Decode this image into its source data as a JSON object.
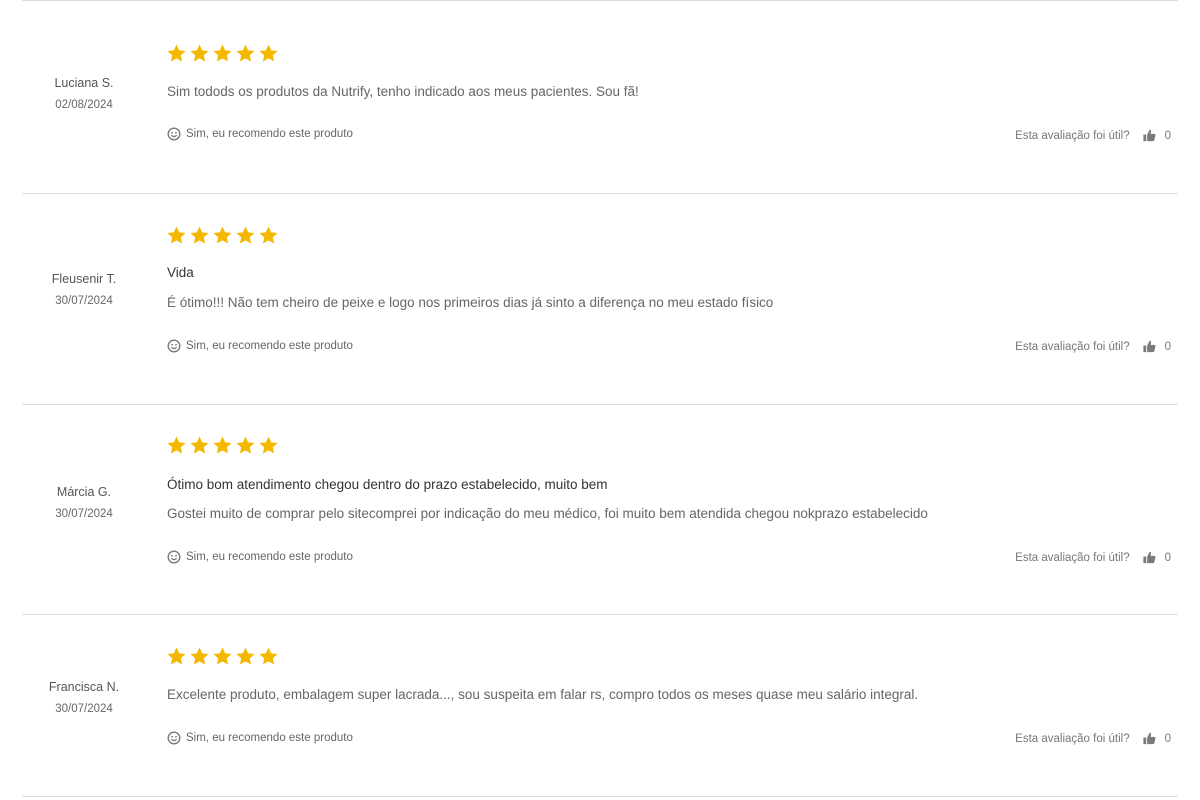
{
  "colors": {
    "star": "#f5b800",
    "divider": "#dcdcdc",
    "icon": "#7a7a7a"
  },
  "icons": {
    "star": "star-icon",
    "recommend": "smiley-face-icon",
    "helpful": "thumbs-up-icon"
  },
  "reviews": [
    {
      "author": "Luciana S.",
      "date": "02/08/2024",
      "rating": 5,
      "max_rating": 5,
      "title": "",
      "text": "Sim todods os produtos da Nutrify, tenho indicado aos meus pacientes. Sou fã!",
      "recommend": "Sim, eu recomendo este produto",
      "helpful_question": "Esta avaliação foi útil?",
      "helpful_count": "0"
    },
    {
      "author": "Fleusenir T.",
      "date": "30/07/2024",
      "rating": 5,
      "max_rating": 5,
      "title": "Vida",
      "text": "É ótimo!!! Não tem cheiro de peixe e logo nos primeiros dias já sinto a diferença no meu estado físico",
      "recommend": "Sim, eu recomendo este produto",
      "helpful_question": "Esta avaliação foi útil?",
      "helpful_count": "0"
    },
    {
      "author": "Márcia G.",
      "date": "30/07/2024",
      "rating": 5,
      "max_rating": 5,
      "title": "Ótimo bom atendimento chegou dentro do prazo estabelecido, muito bem",
      "text": "Gostei muito de comprar pelo sitecomprei por indicação do meu médico, foi muito bem atendida chegou nokprazo estabelecido",
      "recommend": "Sim, eu recomendo este produto",
      "helpful_question": "Esta avaliação foi útil?",
      "helpful_count": "0"
    },
    {
      "author": "Francisca N.",
      "date": "30/07/2024",
      "rating": 5,
      "max_rating": 5,
      "title": "",
      "text": "Excelente produto, embalagem super lacrada..., sou suspeita em falar rs, compro todos os meses quase meu salário integral.",
      "recommend": "Sim, eu recomendo este produto",
      "helpful_question": "Esta avaliação foi útil?",
      "helpful_count": "0"
    }
  ]
}
